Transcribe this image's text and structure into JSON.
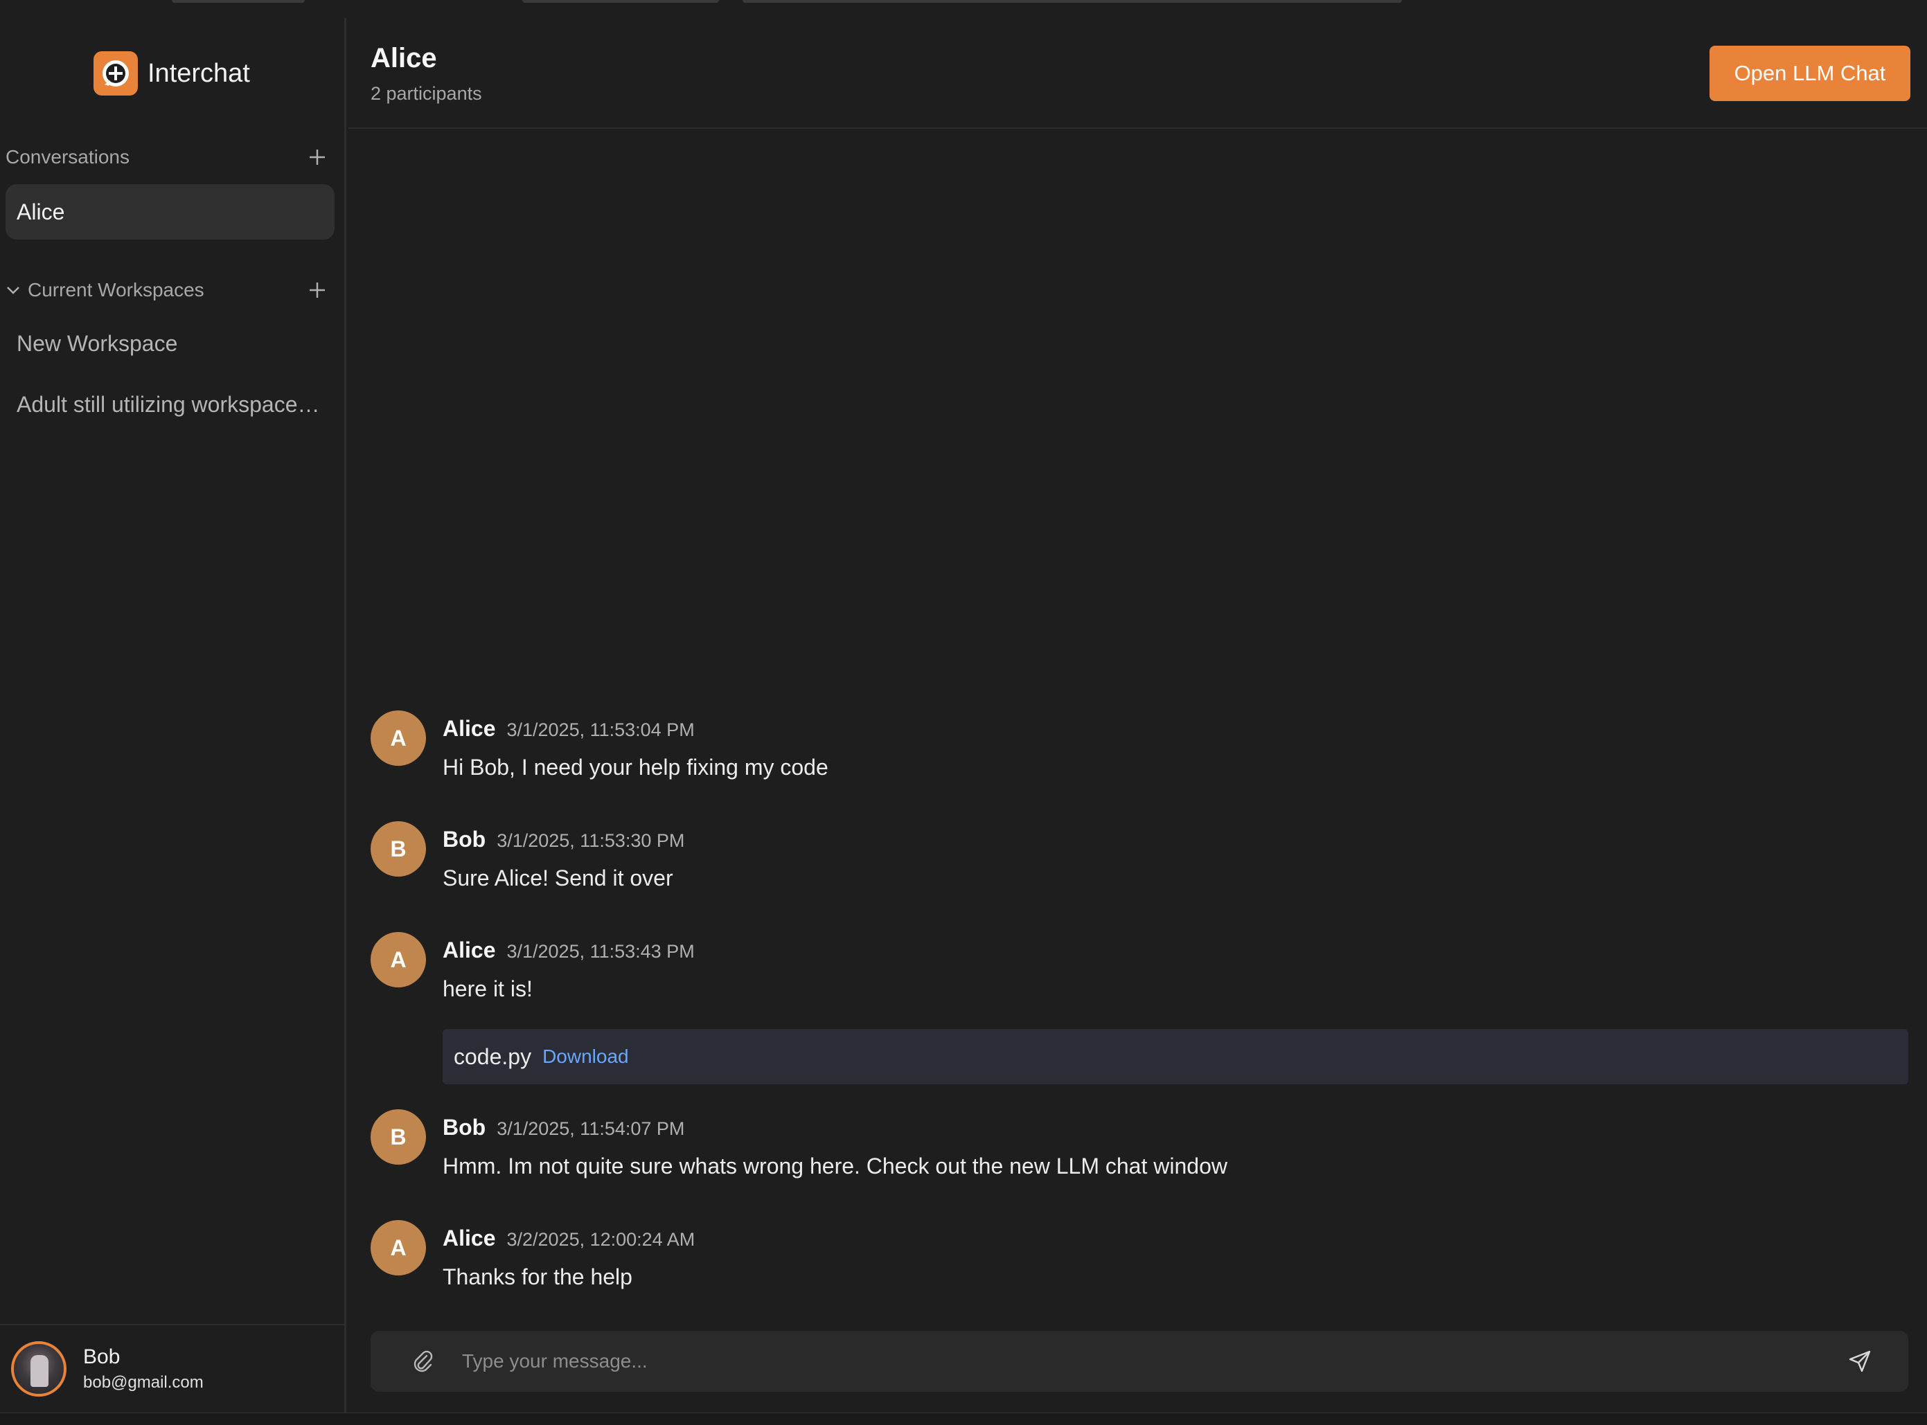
{
  "app": {
    "name": "Interchat",
    "accent_color": "#e9833a",
    "logo_icon": "plus-circle-icon"
  },
  "sidebar": {
    "conversations_label": "Conversations",
    "conversations": [
      {
        "label": "Alice",
        "active": true
      }
    ],
    "workspaces_label": "Current Workspaces",
    "workspaces": [
      {
        "label": "New Workspace"
      },
      {
        "label": "Adult still utilizing workspace…"
      }
    ],
    "user": {
      "name": "Bob",
      "email": "bob@gmail.com"
    }
  },
  "header": {
    "title": "Alice",
    "subtitle": "2 participants",
    "llm_button_label": "Open LLM Chat"
  },
  "messages": [
    {
      "initial": "A",
      "author": "Alice",
      "time": "3/1/2025, 11:53:04 PM",
      "text": "Hi Bob, I need your help fixing my code"
    },
    {
      "initial": "B",
      "author": "Bob",
      "time": "3/1/2025, 11:53:30 PM",
      "text": "Sure Alice! Send it over"
    },
    {
      "initial": "A",
      "author": "Alice",
      "time": "3/1/2025, 11:53:43 PM",
      "text": "here it is!",
      "attachment": {
        "name": "code.py",
        "link_label": "Download"
      }
    },
    {
      "initial": "B",
      "author": "Bob",
      "time": "3/1/2025, 11:54:07 PM",
      "text": "Hmm. Im not quite sure whats wrong here. Check out the new LLM chat window"
    },
    {
      "initial": "A",
      "author": "Alice",
      "time": "3/2/2025, 12:00:24 AM",
      "text": "Thanks for the help"
    }
  ],
  "composer": {
    "placeholder": "Type your message...",
    "value": ""
  }
}
